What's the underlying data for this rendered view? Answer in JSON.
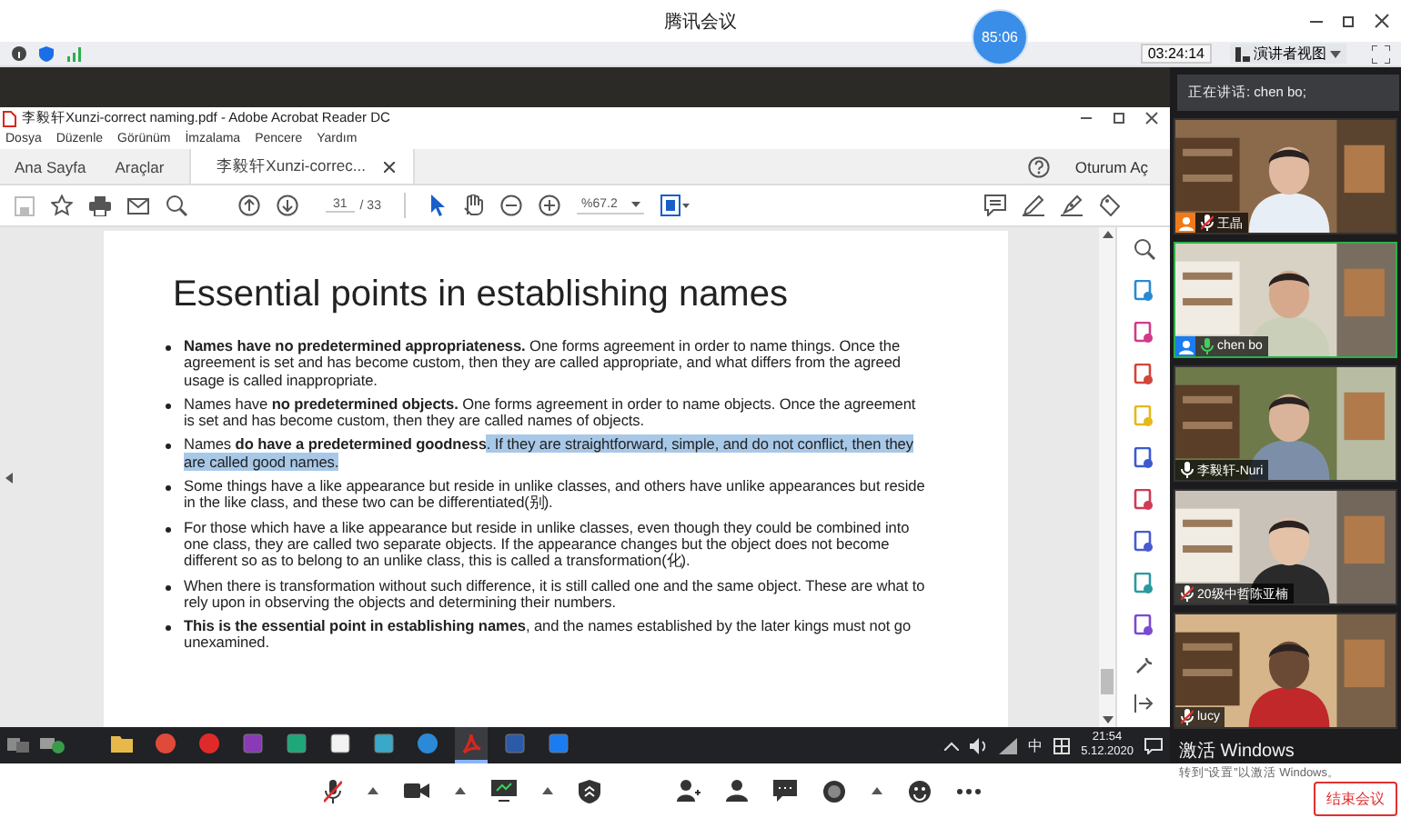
{
  "meeting": {
    "title": "腾讯会议",
    "timer": "85:06",
    "elapsed": "03:24:14",
    "view_button": "演讲者视图",
    "speaker": "正在讲话: chen bo;"
  },
  "acrobat": {
    "title": "李毅轩Xunzi-correct naming.pdf - Adobe Acrobat Reader DC",
    "menu": [
      "Dosya",
      "Düzenle",
      "Görünüm",
      "İmzalama",
      "Pencere",
      "Yardım"
    ],
    "tabs": [
      {
        "label": "Ana Sayfa",
        "selected": false,
        "closable": false
      },
      {
        "label": "Araçlar",
        "selected": false,
        "closable": false
      },
      {
        "label": "李毅轩Xunzi-correc...",
        "selected": true,
        "closable": true
      }
    ],
    "sign_in": "Oturum Aç",
    "page": "31",
    "page_total": "/ 33",
    "zoom": "%67.2",
    "slide": {
      "title": "Essential points in establishing names",
      "bullets": [
        {
          "text": "**Names have no predetermined appropriateness.** One forms agreement in order to name things. Once the agreement is set and has become custom, then they are called appropriate, and what differs from the agreed usage is called inappropriate."
        },
        {
          "text": "Names have **no predetermined objects.** One forms agreement in order to name objects. Once the agreement is set and has become custom, then they are called names of objects."
        },
        {
          "text": "Names **do have a predetermined goodness**",
          "selected_text": ". If they are straightforward, simple, and do not conflict, then they are called good names."
        },
        {
          "text": "Some things have a like appearance but reside in unlike classes, and others have unlike appearances but reside in the like class, and these two can be differentiated(别)."
        },
        {
          "text": "For those which have a like appearance but reside in unlike classes, even though they could be combined into one class, they are called two separate objects. If the appearance changes but the object does not become different so as to belong to an unlike class, this is called a transformation(化)."
        },
        {
          "text": "When  there is transformation without such difference, it is still called one and the same object. These are what to rely upon in observing the objects and determining their numbers."
        },
        {
          "text": "**This is the essential point in establishing names**, and the names established by the later kings must not go unexamined."
        }
      ]
    }
  },
  "taskbar": {
    "apps": [
      {
        "kind": "folder",
        "selected": false
      },
      {
        "kind": "chrome",
        "selected": false
      },
      {
        "kind": "player",
        "selected": false
      },
      {
        "kind": "notes",
        "selected": false
      },
      {
        "kind": "tile",
        "selected": false
      },
      {
        "kind": "notion",
        "selected": false
      },
      {
        "kind": "flow",
        "selected": false
      },
      {
        "kind": "edge",
        "selected": false
      },
      {
        "kind": "pdf",
        "selected": true
      },
      {
        "kind": "word",
        "selected": false
      },
      {
        "kind": "meeting",
        "selected": false
      }
    ],
    "ime": "中",
    "time": "21:54",
    "date": "5.12.2020"
  },
  "participants": [
    {
      "name": "王晶",
      "muted": true,
      "speaking": false,
      "badge": {
        "color": "#f07a1a"
      }
    },
    {
      "name": "chen bo",
      "muted": false,
      "speaking": true,
      "badge": {
        "color": "#1a7cf0"
      }
    },
    {
      "name": "李毅轩-Nuri",
      "muted": false,
      "speaking": false
    },
    {
      "name": "20级中哲陈亚楠",
      "muted": true,
      "speaking": false
    },
    {
      "name": "lucy",
      "muted": true,
      "speaking": false
    }
  ],
  "end_button": "结束会议",
  "os_notice": {
    "title": "激活 Windows",
    "hint": "转到“设置”以激活 Windows。"
  }
}
